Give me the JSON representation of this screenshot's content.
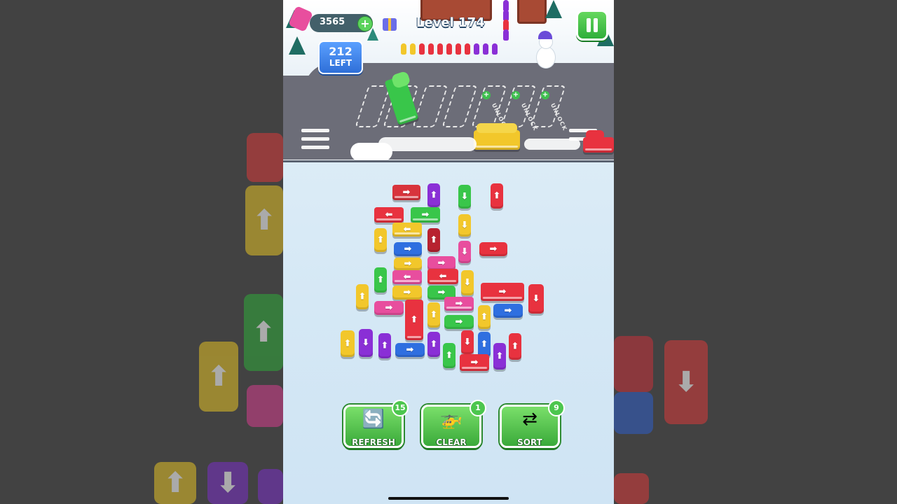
{
  "hud": {
    "coins": "3565",
    "coin_plus": "+",
    "level": "Level 174",
    "left_count": "212",
    "left_label": "LEFT"
  },
  "parking": {
    "unlock_label": "UNLOCK",
    "unlock_plus": "+",
    "locked_slots": 3,
    "open_slots": 3
  },
  "powerups": [
    {
      "label": "REFRESH",
      "count": "15",
      "icon": "refresh-car-icon"
    },
    {
      "label": "CLEAR",
      "count": "1",
      "icon": "helicopter-icon"
    },
    {
      "label": "SORT",
      "count": "9",
      "icon": "sort-passenger-icon"
    }
  ],
  "colors": {
    "red": "#e8323f",
    "green": "#39c64a",
    "yellow": "#f2c72b",
    "blue": "#2f6fe0",
    "purple": "#8a2fd6",
    "pink": "#e84e9e",
    "button_green": "#4cc64e"
  },
  "queue_colors": [
    "yellow",
    "yellow",
    "red",
    "red",
    "red",
    "red",
    "red",
    "red",
    "purple",
    "purple",
    "purple"
  ]
}
